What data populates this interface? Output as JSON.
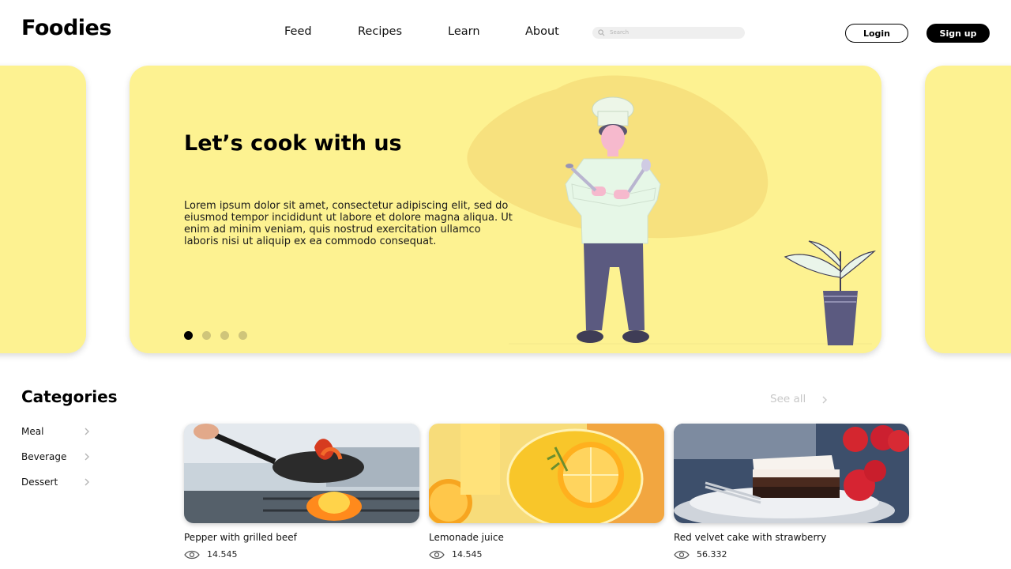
{
  "brand": {
    "name": "Foodies"
  },
  "nav": {
    "items": [
      {
        "label": "Feed"
      },
      {
        "label": "Recipes"
      },
      {
        "label": "Learn"
      },
      {
        "label": "About"
      }
    ],
    "search_placeholder": "Search",
    "login_label": "Login",
    "signup_label": "Sign up"
  },
  "hero": {
    "title": "Let’s cook with us",
    "text": "Lorem ipsum dolor sit amet, consectetur adipiscing elit, sed do eiusmod tempor incididunt ut labore et dolore magna aliqua. Ut enim ad minim veniam, quis nostrud exercitation ullamco laboris nisi ut aliquip ex ea commodo consequat.",
    "slides_count": 4,
    "active_slide": 1,
    "background_color": "#fdf291"
  },
  "categories": {
    "title": "Categories",
    "items": [
      {
        "label": "Meal"
      },
      {
        "label": "Beverage"
      },
      {
        "label": "Dessert"
      }
    ],
    "see_all_label": "See all"
  },
  "cards": [
    {
      "title": "Pepper with grilled beef",
      "views": "14.545"
    },
    {
      "title": "Lemonade juice",
      "views": "14.545"
    },
    {
      "title": "Red velvet cake with strawberry",
      "views": "56.332"
    }
  ]
}
